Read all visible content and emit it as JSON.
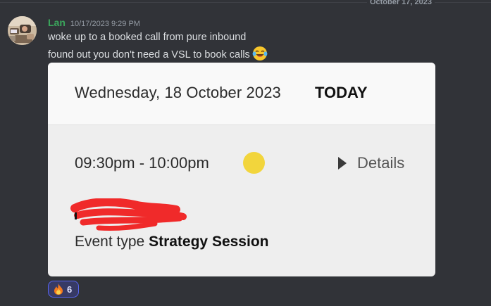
{
  "divider": {
    "date": "October 17, 2023"
  },
  "message": {
    "username": "Lan",
    "timestamp": "10/17/2023 9:29 PM",
    "line1": "woke up to a booked call from pure inbound",
    "line2": "found out you don't need a VSL to book calls",
    "inline_emoji": "joy-laughing-emoji"
  },
  "embed": {
    "date": "Wednesday, 18 October 2023",
    "today": "TODAY",
    "time_range": "09:30pm - 10:00pm",
    "details": "Details",
    "event_type_label": "Event type",
    "event_type_value": "Strategy Session"
  },
  "reaction": {
    "emoji": "fire-emoji",
    "count": "6"
  },
  "colors": {
    "background": "#313338",
    "username": "#3ba55c",
    "reaction_border": "#5865f2",
    "indicator": "#f2d53c"
  }
}
